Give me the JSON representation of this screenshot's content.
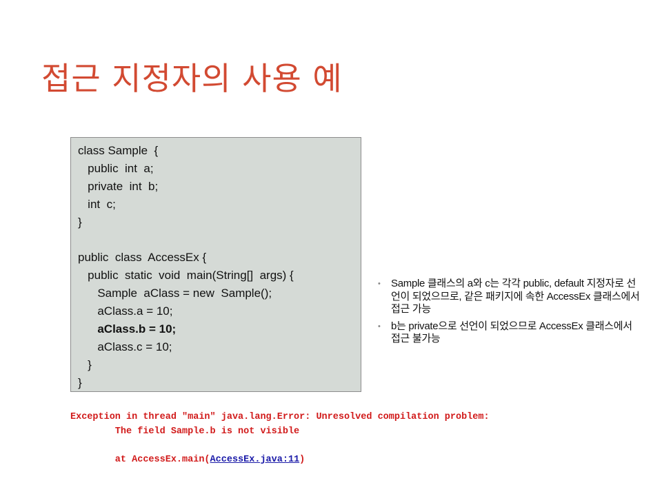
{
  "slide": {
    "title": "접근 지정자의 사용 예"
  },
  "code": {
    "lines": [
      {
        "text": "class Sample  {",
        "bold": false
      },
      {
        "text": "   public  int  a;",
        "bold": false
      },
      {
        "text": "   private  int  b;",
        "bold": false
      },
      {
        "text": "   int  c;",
        "bold": false
      },
      {
        "text": "}",
        "bold": false
      },
      {
        "text": "",
        "bold": false
      },
      {
        "text": "public  class  AccessEx {",
        "bold": false
      },
      {
        "text": "   public  static  void  main(String[]  args) {",
        "bold": false
      },
      {
        "text": "      Sample  aClass = new  Sample();",
        "bold": false
      },
      {
        "text": "      aClass.a = 10;",
        "bold": false
      },
      {
        "text": "      aClass.b = 10;",
        "bold": true
      },
      {
        "text": "      aClass.c = 10;",
        "bold": false
      },
      {
        "text": "   }",
        "bold": false
      },
      {
        "text": "}",
        "bold": false
      }
    ]
  },
  "notes": {
    "bullet_symbol": "•",
    "items": [
      "Sample 클래스의 a와 c는 각각 public, default 지정자로 선언이 되었으므로, 같은 패키지에 속한 AccessEx 클래스에서 접근 가능",
      "b는 private으로 선언이 되었으므로 AccessEx 클래스에서 접근 불가능"
    ]
  },
  "console": {
    "line1": "Exception in thread \"main\" java.lang.Error: Unresolved compilation problem: ",
    "line2": "        The field Sample.b is not visible",
    "line3": "",
    "line4_prefix": "        at AccessEx.main(",
    "line4_link": "AccessEx.java:11",
    "line4_suffix": ")",
    "error_color": "#d11a1a",
    "link_color": "#1a1aa8"
  },
  "colors": {
    "title": "#d24a32",
    "code_background": "#d5dad6"
  }
}
